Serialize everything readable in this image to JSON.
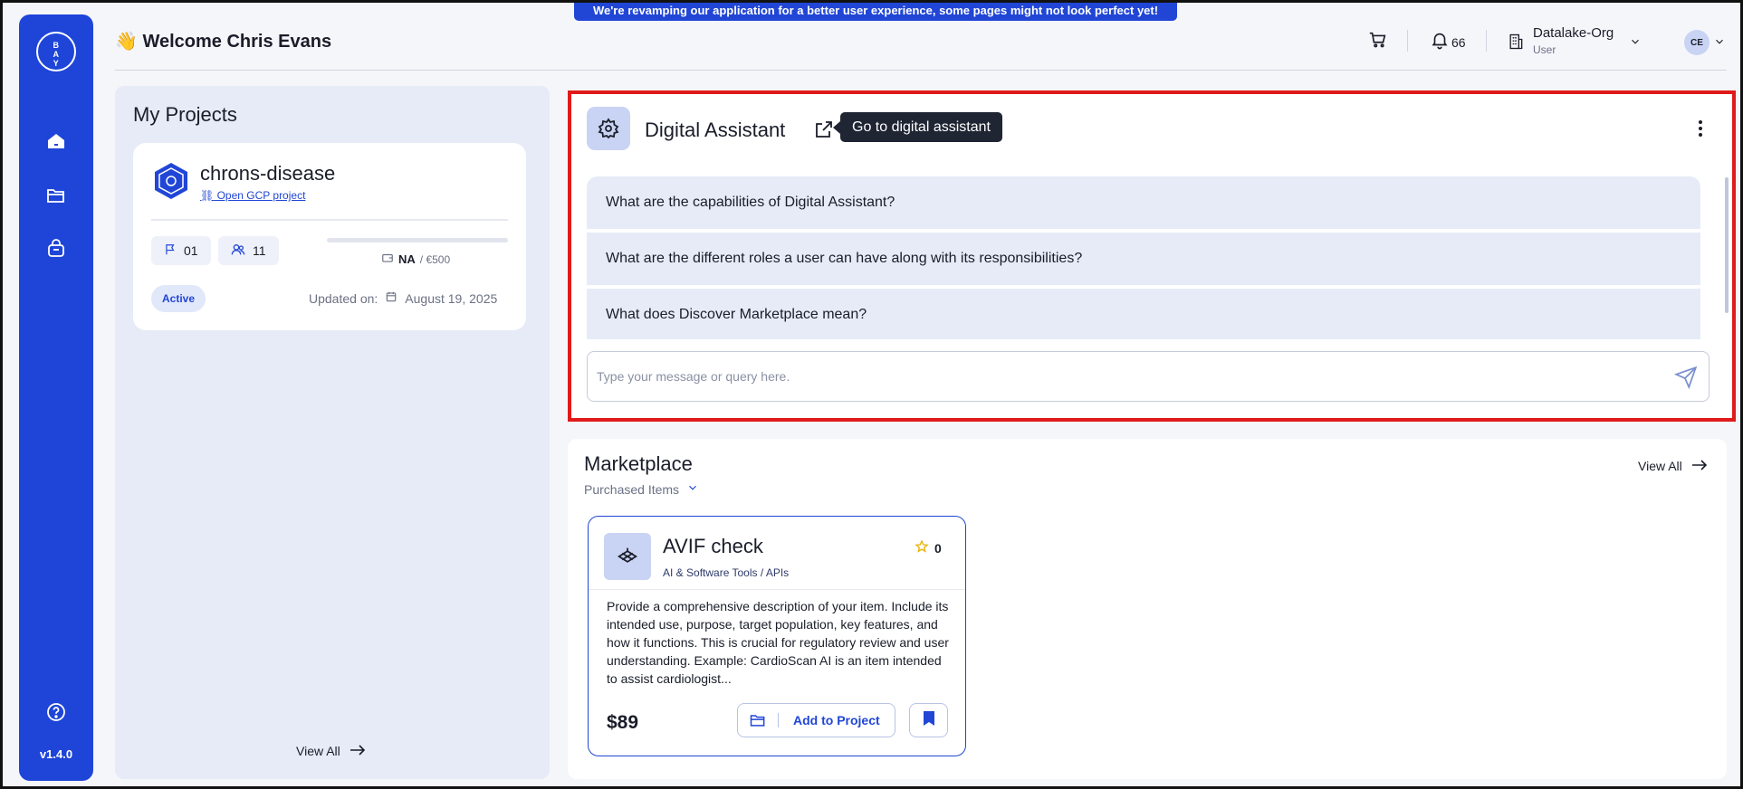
{
  "banner": {
    "text": "We're revamping our application for a better user experience, some pages might not look perfect yet!"
  },
  "sidebar": {
    "logo": "BAYER",
    "items": [
      {
        "icon": "home-icon"
      },
      {
        "icon": "folder-icon"
      },
      {
        "icon": "bag-icon"
      }
    ],
    "help_icon": "help-icon",
    "version": "v1.4.0"
  },
  "header": {
    "welcome": "👋 Welcome Chris Evans",
    "notifications_count": "66",
    "org_name": "Datalake-Org",
    "org_role": "User",
    "avatar_initials": "CE"
  },
  "projects": {
    "title": "My Projects",
    "cards": [
      {
        "name": "chrons-disease",
        "link": "Open GCP project",
        "flags": "01",
        "members": "11",
        "budget_used": "NA",
        "budget_total": "/ €500",
        "status": "Active",
        "updated_label": "Updated on:",
        "updated_date": "August 19, 2025"
      }
    ],
    "view_all": "View All"
  },
  "assistant": {
    "title": "Digital Assistant",
    "tooltip": "Go to digital assistant",
    "questions": [
      "What are the capabilities of Digital Assistant?",
      "What are the different roles a user can have along with its responsibilities?",
      "What does Discover Marketplace mean?"
    ],
    "input_placeholder": "Type your message or query here."
  },
  "marketplace": {
    "title": "Marketplace",
    "filter": "Purchased Items",
    "view_all": "View All",
    "items": [
      {
        "title": "AVIF check",
        "category": "AI & Software Tools / APIs",
        "rating": "0",
        "description": "Provide a comprehensive description of your item. Include its intended use, purpose, target population, key features, and how it functions. This is crucial for regulatory review and user understanding. Example: CardioScan AI is an item intended to assist cardiologist...",
        "price": "$89",
        "add_label": "Add to Project"
      }
    ]
  },
  "colors": {
    "brand": "#1e45d8",
    "highlight": "#e01a1a",
    "tooltip_bg": "#1f2533"
  }
}
